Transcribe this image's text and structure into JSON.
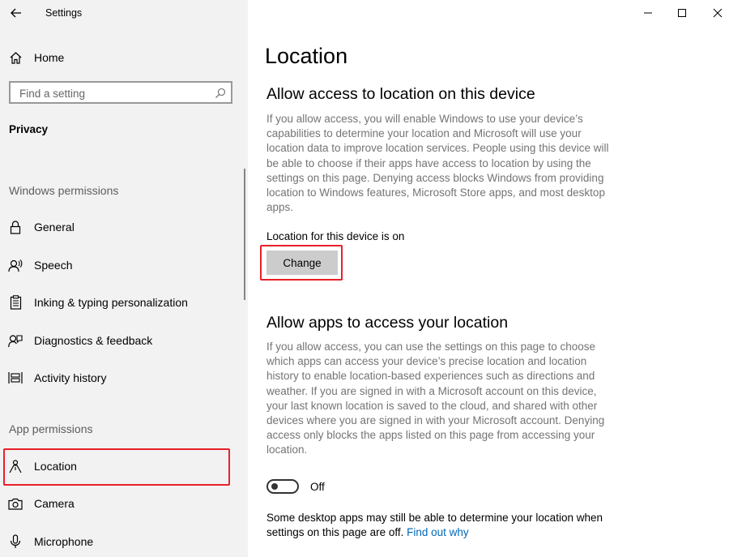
{
  "window": {
    "title": "Settings",
    "controls": [
      "minimize",
      "maximize",
      "close"
    ]
  },
  "sidebar": {
    "home_label": "Home",
    "search_placeholder": "Find a setting",
    "category": "Privacy",
    "windows_permissions_heading": "Windows permissions",
    "windows_permissions": [
      {
        "label": "General",
        "icon": "lock-icon"
      },
      {
        "label": "Speech",
        "icon": "speech-icon"
      },
      {
        "label": "Inking & typing personalization",
        "icon": "clipboard-icon"
      },
      {
        "label": "Diagnostics & feedback",
        "icon": "feedback-icon"
      },
      {
        "label": "Activity history",
        "icon": "activity-history-icon"
      }
    ],
    "app_permissions_heading": "App permissions",
    "app_permissions": [
      {
        "label": "Location",
        "icon": "location-icon",
        "selected": true
      },
      {
        "label": "Camera",
        "icon": "camera-icon"
      },
      {
        "label": "Microphone",
        "icon": "microphone-icon"
      }
    ]
  },
  "main": {
    "title": "Location",
    "device_section": {
      "heading": "Allow access to location on this device",
      "description": "If you allow access, you will enable Windows to use your device’s capabilities to determine your location and Microsoft will use your location data to improve location services. People using this device will be able to choose if their apps have access to location by using the settings on this page. Denying access blocks Windows from providing location to Windows features, Microsoft Store apps, and most desktop apps.",
      "status": "Location for this device is on",
      "change_label": "Change"
    },
    "apps_section": {
      "heading": "Allow apps to access your location",
      "description": "If you allow access, you can use the settings on this page to choose which apps can access your device’s precise location and location history to enable location-based experiences such as directions and weather. If you are signed in with a Microsoft account on this device, your last known location is saved to the cloud, and shared with other devices where you are signed in with your Microsoft account. Denying access only blocks the apps listed on this page from accessing your location.",
      "toggle_state": "Off",
      "toggle_on": false
    },
    "footer": {
      "text": "Some desktop apps may still be able to determine your location when settings on this page are off.",
      "link": "Find out why"
    }
  },
  "colors": {
    "sidebar_bg": "#f2f2f2",
    "highlight": "#e8202a",
    "link": "#0067b8",
    "button_bg": "#cccccc"
  }
}
